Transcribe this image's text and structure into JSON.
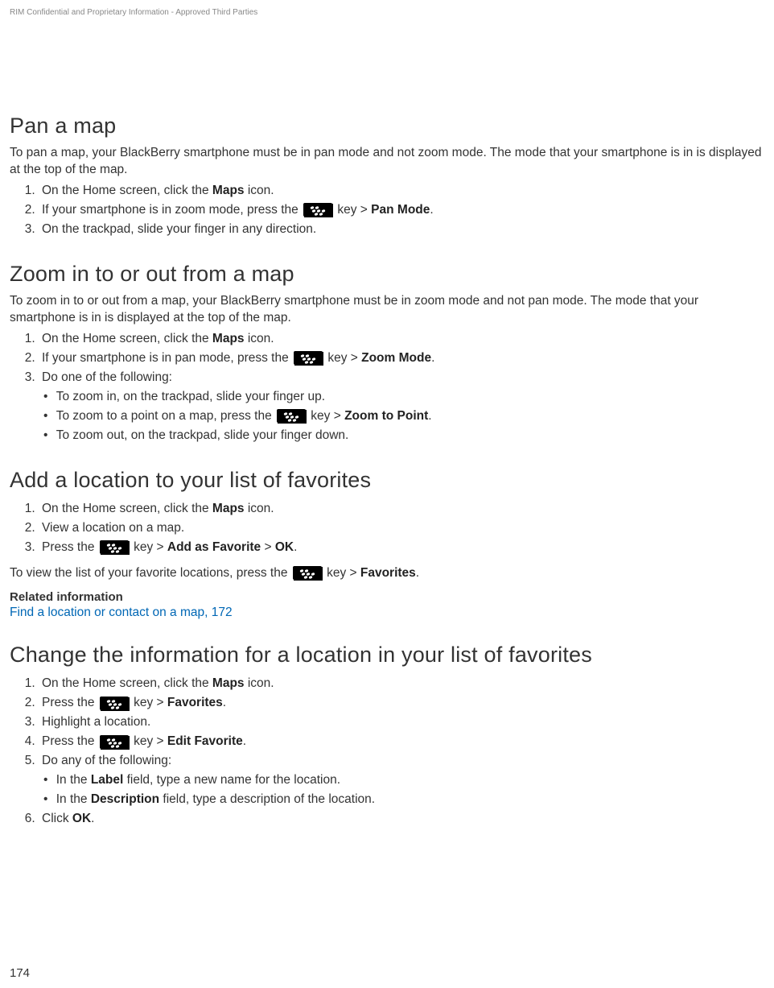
{
  "header": {
    "confidential": "RIM Confidential and Proprietary Information - Approved Third Parties"
  },
  "sections": {
    "pan": {
      "title": "Pan a map",
      "intro": "To pan a map, your BlackBerry smartphone must be in pan mode and not zoom mode. The mode that your smartphone is in is displayed at the top of the map.",
      "step1_a": "On the Home screen, click the ",
      "step1_b": "Maps",
      "step1_c": " icon.",
      "step2_a": "If your smartphone is in zoom mode, press the ",
      "step2_b": " key > ",
      "step2_c": "Pan Mode",
      "step2_d": ".",
      "step3": "On the trackpad, slide your finger in any direction."
    },
    "zoom": {
      "title": "Zoom in to or out from a map",
      "intro": "To zoom in to or out from a map, your BlackBerry smartphone must be in zoom mode and not pan mode. The mode that your smartphone is in is displayed at the top of the map.",
      "step1_a": "On the Home screen, click the ",
      "step1_b": "Maps",
      "step1_c": " icon.",
      "step2_a": "If your smartphone is in pan mode, press the ",
      "step2_b": " key > ",
      "step2_c": "Zoom Mode",
      "step2_d": ".",
      "step3": "Do one of the following:",
      "bullet1": "To zoom in, on the trackpad, slide your finger up.",
      "bullet2_a": "To zoom to a point on a map, press the ",
      "bullet2_b": " key > ",
      "bullet2_c": "Zoom to Point",
      "bullet2_d": ".",
      "bullet3": "To zoom out, on the trackpad, slide your finger down."
    },
    "addfav": {
      "title": "Add a location to your list of favorites",
      "step1_a": "On the Home screen, click the ",
      "step1_b": "Maps",
      "step1_c": " icon.",
      "step2": "View a location on a map.",
      "step3_a": "Press the ",
      "step3_b": " key > ",
      "step3_c": "Add as Favorite",
      "step3_d": " > ",
      "step3_e": "OK",
      "step3_f": ".",
      "follow_a": "To view the list of your favorite locations, press the ",
      "follow_b": " key > ",
      "follow_c": "Favorites",
      "follow_d": ".",
      "related_title": "Related information",
      "related_link": "Find a location or contact on a map, 172"
    },
    "changefav": {
      "title": "Change the information for a location in your list of favorites",
      "step1_a": "On the Home screen, click the ",
      "step1_b": "Maps",
      "step1_c": " icon.",
      "step2_a": "Press the ",
      "step2_b": " key > ",
      "step2_c": "Favorites",
      "step2_d": ".",
      "step3": "Highlight a location.",
      "step4_a": "Press the ",
      "step4_b": " key > ",
      "step4_c": "Edit Favorite",
      "step4_d": ".",
      "step5": "Do any of the following:",
      "bullet1_a": "In the ",
      "bullet1_b": "Label",
      "bullet1_c": " field, type a new name for the location.",
      "bullet2_a": "In the ",
      "bullet2_b": "Description",
      "bullet2_c": " field, type a description of the location.",
      "step6_a": "Click ",
      "step6_b": "OK",
      "step6_c": "."
    }
  },
  "footer": {
    "page": "174"
  }
}
